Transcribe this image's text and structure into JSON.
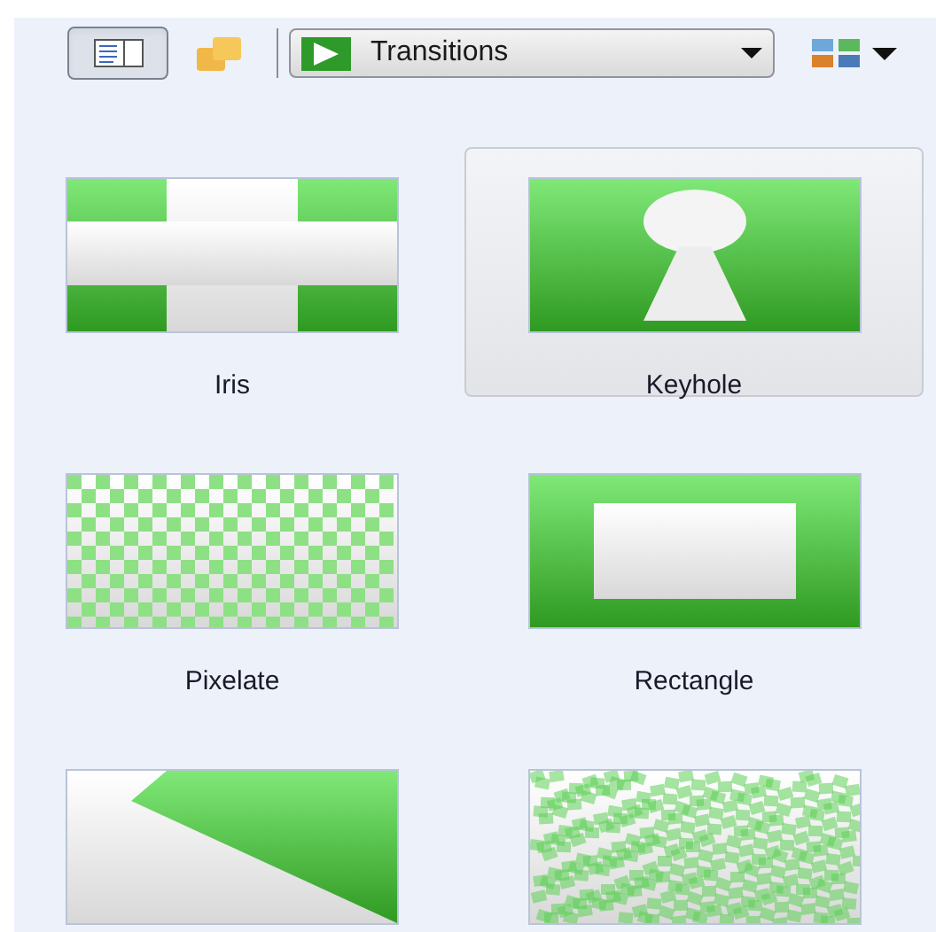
{
  "toolbar": {
    "details_pane": {
      "selected": true
    },
    "category_dropdown": {
      "value": "Transitions"
    }
  },
  "tiles": [
    {
      "kind": "iris",
      "label": "Iris",
      "selected": false
    },
    {
      "kind": "keyhole",
      "label": "Keyhole",
      "selected": true
    },
    {
      "kind": "pixelate",
      "label": "Pixelate",
      "selected": false
    },
    {
      "kind": "rectangle",
      "label": "Rectangle",
      "selected": false
    },
    {
      "kind": "wipe",
      "selected": false
    },
    {
      "kind": "dissolve",
      "selected": false
    }
  ]
}
